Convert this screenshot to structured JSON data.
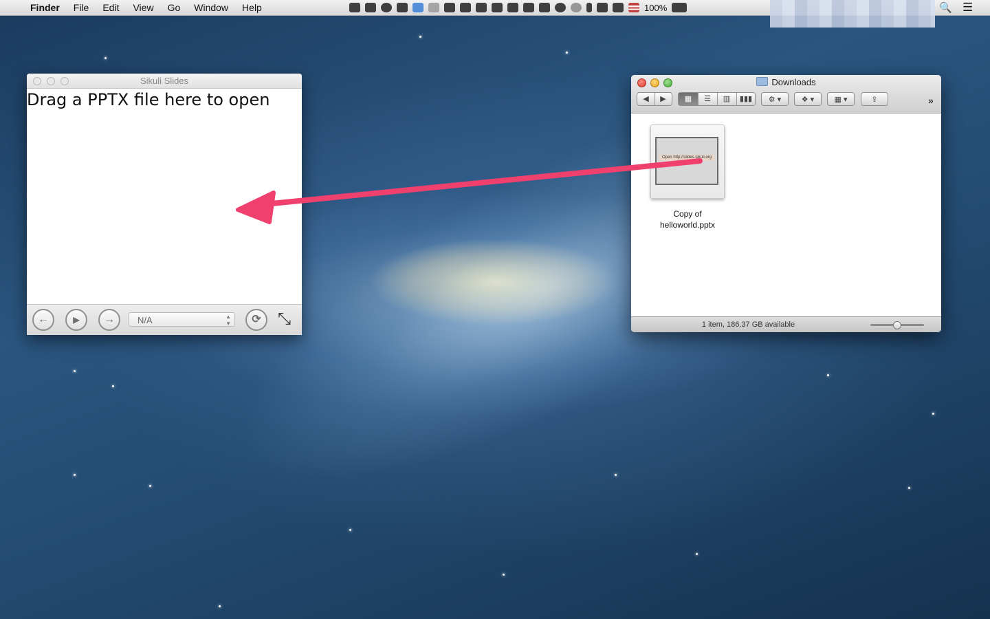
{
  "menubar": {
    "apple_icon": "",
    "items": [
      "Finder",
      "File",
      "Edit",
      "View",
      "Go",
      "Window",
      "Help"
    ],
    "battery_text": "100%",
    "status_icons": [
      "relay-icon",
      "evernote-icon",
      "sync-icon",
      "hat-icon",
      "dropbox-icon",
      "drive-icon",
      "screen-icon",
      "hat-icon",
      "bell-icon",
      "copy-icon",
      "cloud-icon",
      "key-icon",
      "memory-icon",
      "refresh-icon",
      "time-machine-icon",
      "bluetooth-icon",
      "wifi-icon",
      "volume-icon",
      "us-flag-icon",
      "battery-icon"
    ]
  },
  "sikuli": {
    "title": "Sikuli Slides",
    "drop_hint": "Drag a PPTX file here to open",
    "slide_select_value": "N/A",
    "prev_icon": "←",
    "play_icon": "▶",
    "next_icon": "→",
    "refresh_icon": "⟳",
    "fullscreen_icon": "⤡"
  },
  "finder": {
    "title": "Downloads",
    "back_icon": "◀",
    "forward_icon": "▶",
    "file": {
      "name_line1": "Copy of",
      "name_line2": "helloworld.pptx",
      "thumb_text": "Open http://slides.sikuli.org"
    },
    "status_text": "1 item, 186.37 GB available",
    "overflow_icon": "»",
    "zoom_level": 0.5
  },
  "colors": {
    "arrow": "#f0416e",
    "menubar": "#e6e6e6"
  }
}
